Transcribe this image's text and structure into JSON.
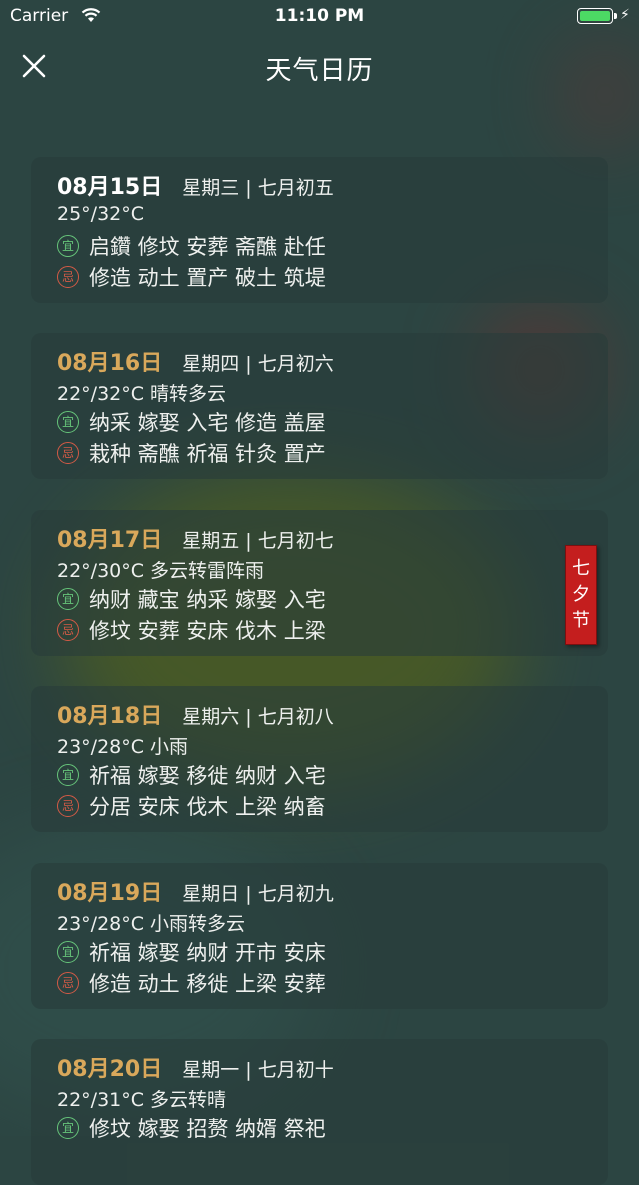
{
  "status_bar": {
    "carrier": "Carrier",
    "time": "11:10 PM"
  },
  "nav": {
    "title": "天气日历"
  },
  "yi_badge": "宜",
  "ji_badge": "忌",
  "festival": {
    "chars": [
      "七",
      "夕",
      "节"
    ]
  },
  "days": [
    {
      "date": "08月15日",
      "week": "星期三 | 七月初五",
      "weather": "25°/32°C",
      "yi": "启鑽 修坟 安葬 斋醮 赴任",
      "ji": "修造 动土 置产 破土 筑堤"
    },
    {
      "date": "08月16日",
      "week": "星期四 | 七月初六",
      "weather": "22°/32°C 晴转多云",
      "yi": "纳采 嫁娶 入宅 修造 盖屋",
      "ji": "栽种 斋醮 祈福 针灸 置产"
    },
    {
      "date": "08月17日",
      "week": "星期五 | 七月初七",
      "weather": "22°/30°C 多云转雷阵雨",
      "yi": "纳财 藏宝 纳采 嫁娶 入宅",
      "ji": "修坟 安葬 安床 伐木 上梁"
    },
    {
      "date": "08月18日",
      "week": "星期六 | 七月初八",
      "weather": "23°/28°C 小雨",
      "yi": "祈福 嫁娶 移徙 纳财 入宅",
      "ji": "分居 安床 伐木 上梁 纳畜"
    },
    {
      "date": "08月19日",
      "week": "星期日 | 七月初九",
      "weather": "23°/28°C 小雨转多云",
      "yi": "祈福 嫁娶 纳财 开市 安床",
      "ji": "修造 动土 移徙 上梁 安葬"
    },
    {
      "date": "08月20日",
      "week": "星期一 | 七月初十",
      "weather": "22°/31°C 多云转晴",
      "yi": "修坟 嫁娶 招赘 纳婿 祭祀",
      "ji": ""
    }
  ]
}
